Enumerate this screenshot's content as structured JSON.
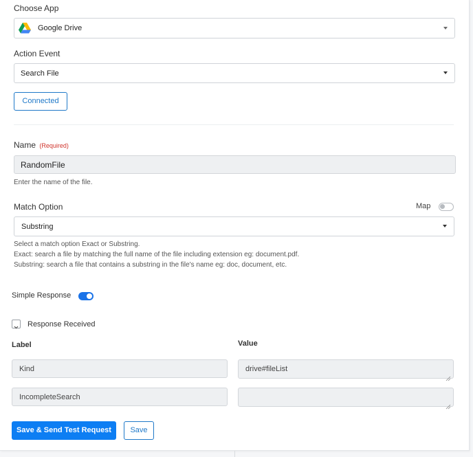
{
  "choose_app": {
    "label": "Choose App",
    "selected": "Google Drive",
    "app_icon": "google-drive-icon"
  },
  "action_event": {
    "label": "Action Event",
    "selected": "Search File"
  },
  "connected_button": "Connected",
  "name_field": {
    "label": "Name",
    "required": "(Required)",
    "value": "RandomFile",
    "hint": "Enter the name of the file."
  },
  "match_option": {
    "label": "Match Option",
    "map_label": "Map",
    "selected": "Substring",
    "hints": [
      "Select a match option Exact or Substring.",
      "Exact: search a file by matching the full name of the file including extension eg: document.pdf.",
      "Substring: search a file that contains a substring in the file's name eg: doc, document, etc."
    ]
  },
  "simple_response": {
    "label": "Simple Response"
  },
  "response_received": {
    "label": "Response Received",
    "label_header": "Label",
    "value_header": "Value",
    "rows": [
      {
        "label": "Kind",
        "value": "drive#fileList"
      },
      {
        "label": "IncompleteSearch",
        "value": ""
      }
    ]
  },
  "buttons": {
    "save_send": "Save & Send Test Request",
    "save": "Save"
  },
  "colors": {
    "accent": "#0d7ef3",
    "required": "#d0342c",
    "toggle_on": "#1a73e8"
  }
}
